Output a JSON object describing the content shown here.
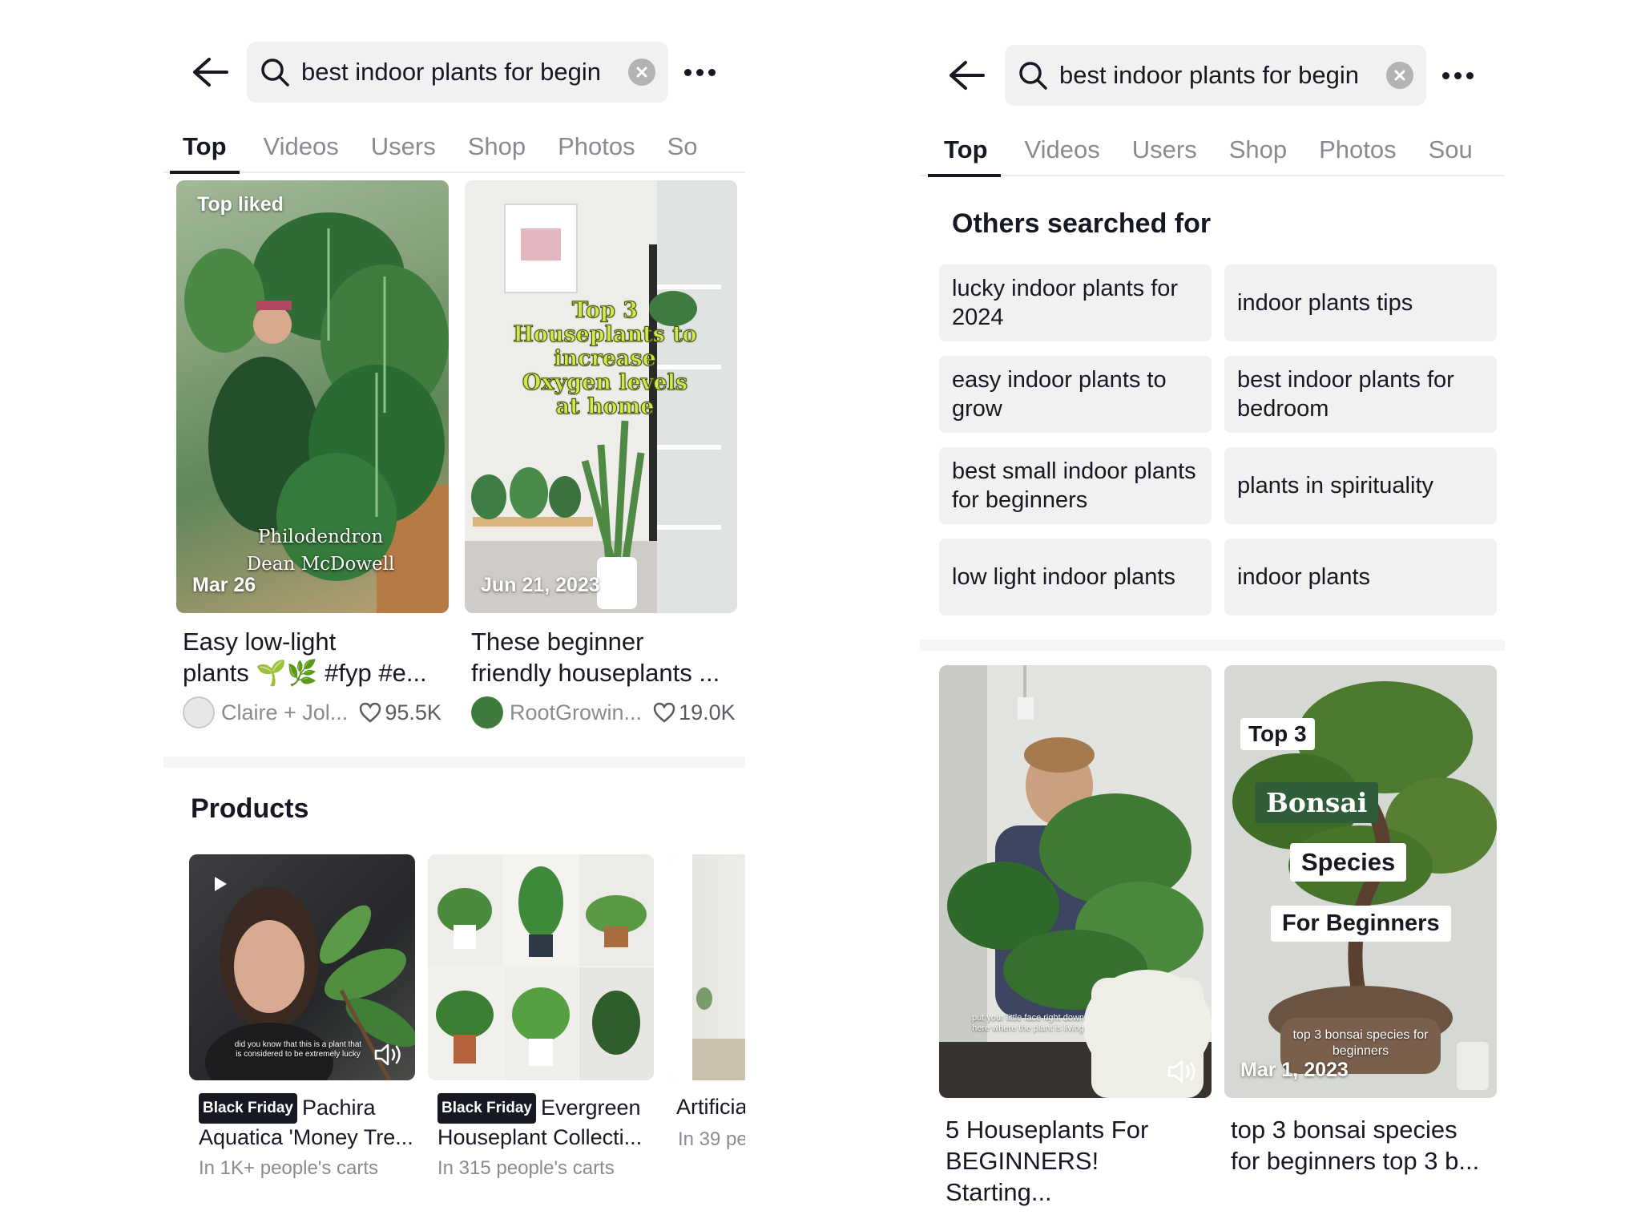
{
  "left": {
    "search": {
      "query": "best indoor plants for begin"
    },
    "tabs": [
      "Top",
      "Videos",
      "Users",
      "Shop",
      "Photos",
      "So"
    ],
    "videos": [
      {
        "badge": "Top liked",
        "overlay_text": [
          "Philodendron",
          "Dean McDowell"
        ],
        "date": "Mar 26",
        "title_line1": "Easy low-light",
        "title_line2": "plants 🌱🌿 #fyp #e...",
        "author": "Claire + Jol...",
        "likes": "95.5K"
      },
      {
        "overlay_text": [
          "Top 3",
          "Houseplants to",
          "increase",
          "Oxygen levels",
          "at home"
        ],
        "date": "Jun 21, 2023",
        "title_line1": "These beginner",
        "title_line2": "friendly houseplants ...",
        "author": "RootGrowin...",
        "likes": "19.0K"
      }
    ],
    "products_title": "Products",
    "products": [
      {
        "badge": "Black Friday",
        "title": "Pachira Aquatica 'Money Tre...",
        "carts": "In 1K+ people's carts",
        "caption": "did you know that this is a plant that is considered to be extremely lucky"
      },
      {
        "badge": "Black Friday",
        "title": "Evergreen Houseplant Collecti...",
        "carts": "In 315 people's carts"
      },
      {
        "title": "Artificia",
        "carts": "In 39 pe"
      }
    ]
  },
  "right": {
    "search": {
      "query": "best indoor plants for begin"
    },
    "tabs": [
      "Top",
      "Videos",
      "Users",
      "Shop",
      "Photos",
      "Sou"
    ],
    "others_title": "Others searched for",
    "others": [
      "lucky indoor plants for 2024",
      "indoor plants tips",
      "easy indoor plants to grow",
      "best indoor plants for bedroom",
      "best small indoor plants for beginners",
      "plants in spirituality",
      "low light indoor plants",
      "indoor plants"
    ],
    "videos": [
      {
        "caption": "put your little face right down here where the plant is living",
        "title_line1": "5 Houseplants  For",
        "title_line2": "BEGINNERS! Starting..."
      },
      {
        "overlay": [
          "Top 3",
          "Bonsai",
          "Species",
          "For Beginners"
        ],
        "caption": "top 3 bonsai species for beginners",
        "date": "Mar 1, 2023",
        "title_line1": "top 3 bonsai species",
        "title_line2": "for beginners top 3 b..."
      }
    ]
  },
  "colors": {
    "text": "#161823",
    "muted": "#8a8b91",
    "chip_bg": "#f1f1f2",
    "divider": "#f6f6f6",
    "overlay_yellow": "#d4e84a",
    "bonsai_green": "#2f5d3a"
  },
  "icons": [
    "back-arrow-icon",
    "search-icon",
    "clear-icon",
    "more-icon",
    "heart-icon",
    "sound-icon",
    "play-icon"
  ]
}
